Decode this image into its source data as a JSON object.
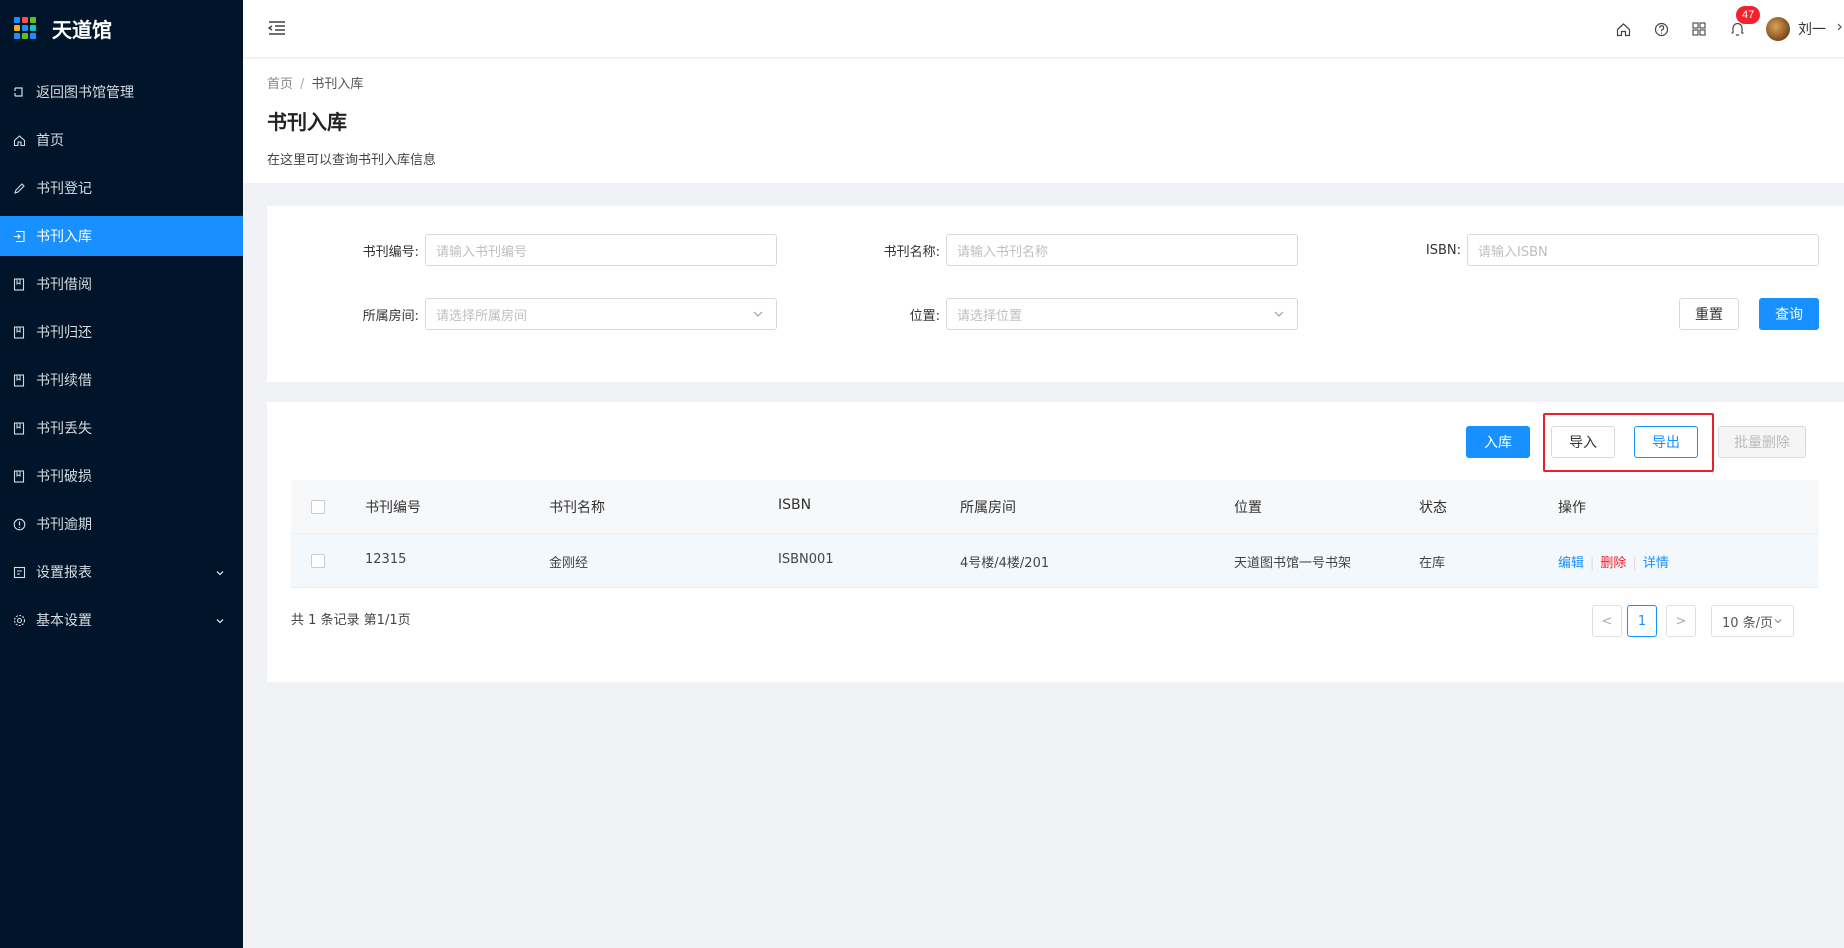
{
  "app": {
    "title": "天道馆",
    "logo_colors": [
      "#1890ff",
      "#ff4d4f",
      "#52c41a",
      "#faad14",
      "#1890ff",
      "#13c2c2",
      "#1890ff",
      "#52c41a",
      "#1890ff"
    ]
  },
  "sidebar": {
    "items": [
      {
        "label": "返回图书馆管理",
        "icon": "return-icon"
      },
      {
        "label": "首页",
        "icon": "home-icon"
      },
      {
        "label": "书刊登记",
        "icon": "pen-icon"
      },
      {
        "label": "书刊入库",
        "icon": "login-icon",
        "active": true
      },
      {
        "label": "书刊借阅",
        "icon": "book-icon"
      },
      {
        "label": "书刊归还",
        "icon": "book-icon"
      },
      {
        "label": "书刊续借",
        "icon": "book-icon"
      },
      {
        "label": "书刊丢失",
        "icon": "book-icon"
      },
      {
        "label": "书刊破损",
        "icon": "book-icon"
      },
      {
        "label": "书刊逾期",
        "icon": "info-circle-icon"
      },
      {
        "label": "设置报表",
        "icon": "report-icon",
        "expandable": true
      },
      {
        "label": "基本设置",
        "icon": "gear-icon",
        "expandable": true
      }
    ]
  },
  "header": {
    "notification_count": "47",
    "user_name": "刘一"
  },
  "page": {
    "breadcrumb": [
      "首页",
      "书刊入库"
    ],
    "breadcrumb_sep": "/",
    "title": "书刊入库",
    "description": "在这里可以查询书刊入库信息"
  },
  "search": {
    "book_no_label": "书刊编号:",
    "book_no_placeholder": "请输入书刊编号",
    "book_name_label": "书刊名称:",
    "book_name_placeholder": "请输入书刊名称",
    "isbn_label": "ISBN:",
    "isbn_placeholder": "请输入ISBN",
    "room_label": "所属房间:",
    "room_placeholder": "请选择所属房间",
    "location_label": "位置:",
    "location_placeholder": "请选择位置",
    "reset_label": "重置",
    "query_label": "查询"
  },
  "toolbar": {
    "stock_in_label": "入库",
    "import_label": "导入",
    "export_label": "导出",
    "batch_delete_label": "批量删除"
  },
  "table": {
    "columns": [
      "书刊编号",
      "书刊名称",
      "ISBN",
      "所属房间",
      "位置",
      "状态",
      "操作"
    ],
    "rows": [
      {
        "book_no": "12315",
        "name": "金刚经",
        "isbn": "ISBN001",
        "room": "4号楼/4楼/201",
        "location": "天道图书馆一号书架",
        "status": "在库"
      }
    ],
    "actions": {
      "edit": "编辑",
      "delete": "删除",
      "detail": "详情"
    }
  },
  "pagination": {
    "summary": "共 1 条记录 第1/1页",
    "current_page": "1",
    "page_size": "10 条/页",
    "prev": "<",
    "next": ">"
  },
  "colors": {
    "primary": "#1890ff",
    "sidebar_bg": "#001529",
    "danger": "#f5222d",
    "highlight": "#e8202a"
  }
}
